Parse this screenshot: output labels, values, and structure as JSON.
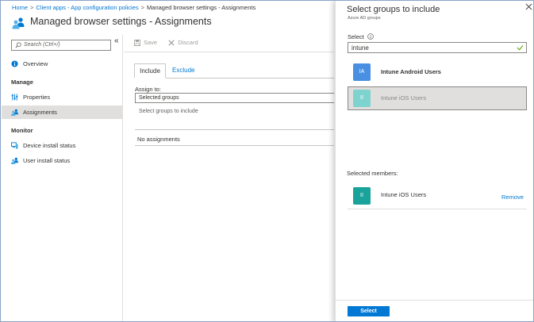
{
  "breadcrumb": {
    "items": [
      "Home",
      "Client apps - App configuration policies",
      "Managed browser settings - Assignments"
    ],
    "separator": ">"
  },
  "page": {
    "title": "Managed browser settings - Assignments",
    "icon": "people-icon"
  },
  "leftnav": {
    "search_placeholder": "Search (Ctrl+/)",
    "collapse_glyph": "«",
    "overview": "Overview",
    "manage_header": "Manage",
    "properties": "Properties",
    "assignments": "Assignments",
    "monitor_header": "Monitor",
    "device_install_status": "Device install status",
    "user_install_status": "User install status"
  },
  "toolbar": {
    "save_label": "Save",
    "discard_label": "Discard"
  },
  "tabs": {
    "include": "Include",
    "exclude": "Exclude"
  },
  "assign": {
    "label": "Assign to:",
    "value": "Selected groups",
    "select_groups_link": "Select groups to include",
    "no_assignments": "No assignments"
  },
  "blade": {
    "title": "Select groups to include",
    "subtitle": "Azure AD groups",
    "select_label": "Select",
    "search_value": "intune",
    "results": [
      {
        "initials": "IA",
        "name": "Intune Android Users",
        "color": "#4a90e2",
        "selected": false
      },
      {
        "initials": "II",
        "name": "Intune iOS Users",
        "color": "#7fd3cf",
        "selected": true
      }
    ],
    "selected_members_label": "Selected members:",
    "members": [
      {
        "initials": "II",
        "name": "Intune iOS Users",
        "color": "#1aa39a"
      }
    ],
    "remove_label": "Remove",
    "select_button": "Select"
  },
  "colors": {
    "accent": "#0078d4",
    "border": "#8aa4c8"
  }
}
